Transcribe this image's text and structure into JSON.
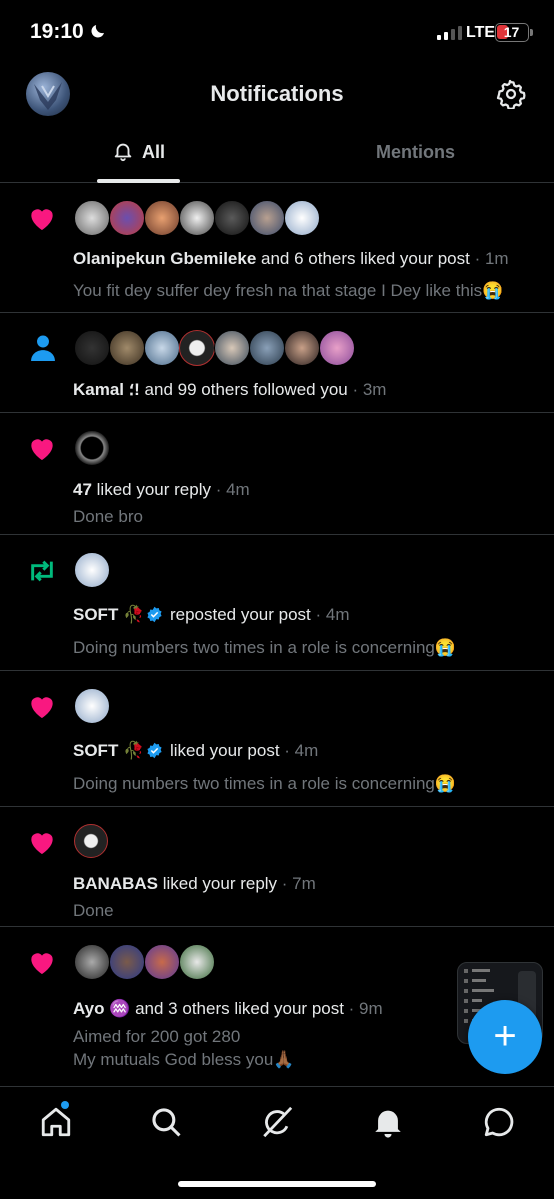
{
  "status_bar": {
    "time": "19:10",
    "network": "LTE",
    "battery": "17"
  },
  "header": {
    "title": "Notifications",
    "avatar": "profile-avatar",
    "settings_icon": "gear-icon"
  },
  "tabs": [
    {
      "label": "All",
      "icon": "bell-icon",
      "active": true
    },
    {
      "label": "Mentions",
      "active": false
    }
  ],
  "notifications": [
    {
      "type": "like",
      "icon": "heart-icon",
      "avatar_count": 7,
      "name": "Olanipekun Gbemileke",
      "action": " and 6 others liked your post",
      "time": " · 1m",
      "text": "You fit dey suffer dey fresh na that stage I Dey like this😭"
    },
    {
      "type": "follow",
      "icon": "person-icon",
      "avatar_count": 8,
      "name": "Kamal ؛!",
      "action": " and 99 others followed you",
      "time": " · 3m"
    },
    {
      "type": "like",
      "icon": "heart-icon",
      "avatar_count": 1,
      "name": "47",
      "action": " liked your reply",
      "time": " · 4m",
      "text": "Done bro"
    },
    {
      "type": "repost",
      "icon": "repost-icon",
      "avatar_count": 1,
      "name": "SOFT 🥀",
      "action": " reposted your post",
      "time": " · 4m",
      "verified": true,
      "text": "Doing numbers two times in a role is concerning😭"
    },
    {
      "type": "like",
      "icon": "heart-icon",
      "avatar_count": 1,
      "name": "SOFT 🥀",
      "action": " liked your post",
      "time": " · 4m",
      "verified": true,
      "text": "Doing numbers two times in a role is concerning😭"
    },
    {
      "type": "like",
      "icon": "heart-icon",
      "avatar_count": 1,
      "name": "BANABAS",
      "action": " liked your reply",
      "time": " · 7m",
      "text": "Done"
    },
    {
      "type": "like",
      "icon": "heart-icon",
      "avatar_count": 4,
      "name": "Ayo ♒️",
      "action": " and 3 others liked your post",
      "time": " · 9m",
      "text": "Aimed for 200 got 280",
      "text2": "My mutuals God bless you🙏🏾"
    }
  ],
  "fab": {
    "label": "+"
  },
  "bottom_nav": [
    {
      "name": "home-icon",
      "badge": true
    },
    {
      "name": "search-icon"
    },
    {
      "name": "grok-icon"
    },
    {
      "name": "notifications-bell-icon"
    },
    {
      "name": "messages-icon"
    }
  ],
  "colors": {
    "background": "#000000",
    "text": "#e7e9ea",
    "secondary": "#71767b",
    "accent": "#1d9bf0",
    "like": "#f91880",
    "repost": "#00ba7c",
    "divider": "#2f3336"
  }
}
